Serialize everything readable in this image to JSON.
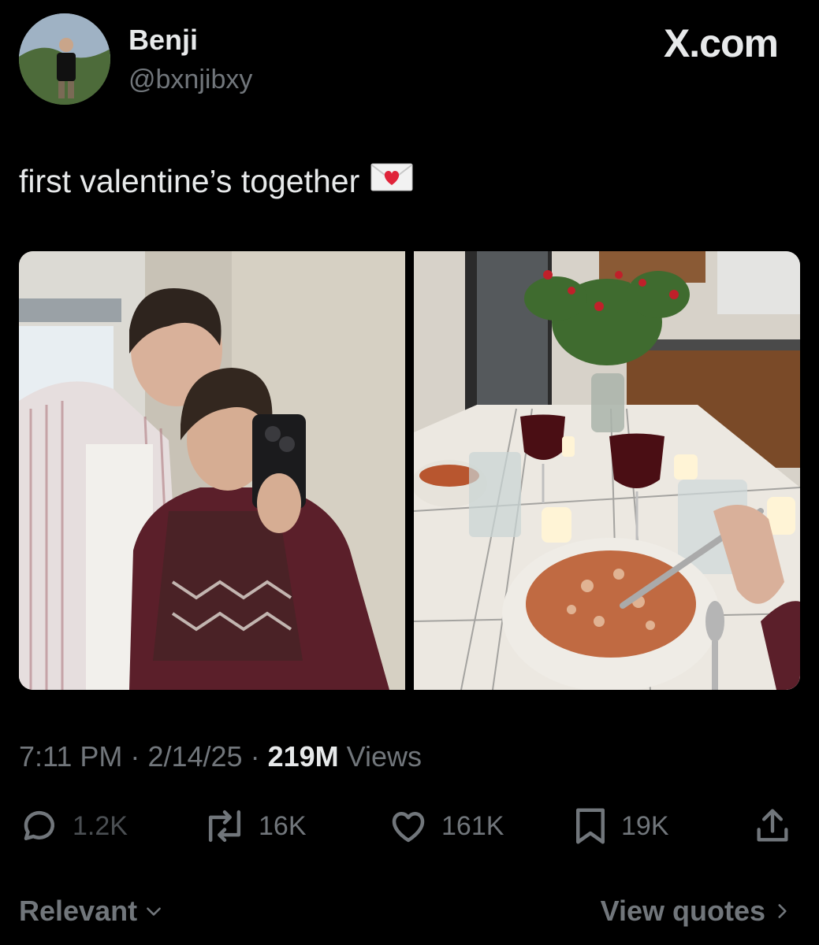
{
  "header": {
    "display_name": "Benji",
    "handle": "@bxnjibxy",
    "brand": "X.com"
  },
  "tweet": {
    "text": "first valentine’s together",
    "emoji_icon": "love-letter-icon"
  },
  "media": {
    "photo_count": 2
  },
  "meta": {
    "time": "7:11 PM",
    "sep1": "·",
    "date": "2/14/25",
    "sep2": "·",
    "views_count": "219M",
    "views_label": "Views"
  },
  "actions": {
    "replies": "1.2K",
    "reposts": "16K",
    "likes": "161K",
    "bookmarks": "19K"
  },
  "footer": {
    "sort_label": "Relevant",
    "quotes_label": "View quotes"
  },
  "colors": {
    "background": "#000000",
    "text_primary": "#e7e9ea",
    "text_secondary": "#71767b"
  }
}
